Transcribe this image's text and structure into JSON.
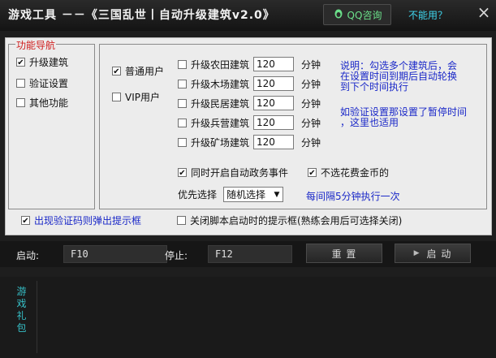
{
  "titlebar": {
    "title": "游戏工具 －－《三国乱世丨自动升级建筑v2.0》",
    "qq_label": "QQ咨询",
    "help_link": "不能用？",
    "close_symbol": "×"
  },
  "nav": {
    "title": "功能导航",
    "items": [
      {
        "label": "升级建筑",
        "checked": true
      },
      {
        "label": "验证设置",
        "checked": false
      },
      {
        "label": "其他功能",
        "checked": false
      }
    ]
  },
  "settings": {
    "user_types": [
      {
        "label": "普通用户",
        "checked": true
      },
      {
        "label": "VIP用户",
        "checked": false
      }
    ],
    "buildings": [
      {
        "label": "升级农田建筑",
        "value": "120",
        "unit": "分钟",
        "checked": false
      },
      {
        "label": "升级木场建筑",
        "value": "120",
        "unit": "分钟",
        "checked": false
      },
      {
        "label": "升级民居建筑",
        "value": "120",
        "unit": "分钟",
        "checked": false
      },
      {
        "label": "升级兵营建筑",
        "value": "120",
        "unit": "分钟",
        "checked": false
      },
      {
        "label": "升级矿场建筑",
        "value": "120",
        "unit": "分钟",
        "checked": false
      }
    ],
    "note1_lines": [
      "说明：勾选多个建筑后，会",
      "在设置时间到期后自动轮换",
      "到下个时间执行"
    ],
    "note2_lines": [
      "如验证设置那设置了暂停时间",
      "，这里也适用"
    ],
    "auto_affairs": {
      "label": "同时开启自动政务事件",
      "checked": true
    },
    "no_gold": {
      "label": "不选花费金币的",
      "checked": true
    },
    "priority_label": "优先选择",
    "priority_value": "随机选择",
    "interval_text": "每间隔5分钟执行一次"
  },
  "options": {
    "captcha_popup": {
      "label": "出现验证码则弹出提示框",
      "checked": true
    },
    "close_startup": {
      "label": "关闭脚本启动时的提示框(熟练会用后可选择关闭)",
      "checked": false
    }
  },
  "controls": {
    "start_label": "启动:",
    "start_key": "F10",
    "stop_label": "停止:",
    "stop_key": "F12",
    "reset_button": "重 置",
    "run_button": "启 动"
  },
  "bag": {
    "tab_label": "游戏礼包"
  },
  "colors": {
    "accent_blue": "#1a28c8",
    "nav_title_red": "#d02020",
    "qq_green": "#6be08a",
    "link_cyan": "#3fd6ee",
    "bag_tab_cyan": "#36c0c8"
  }
}
